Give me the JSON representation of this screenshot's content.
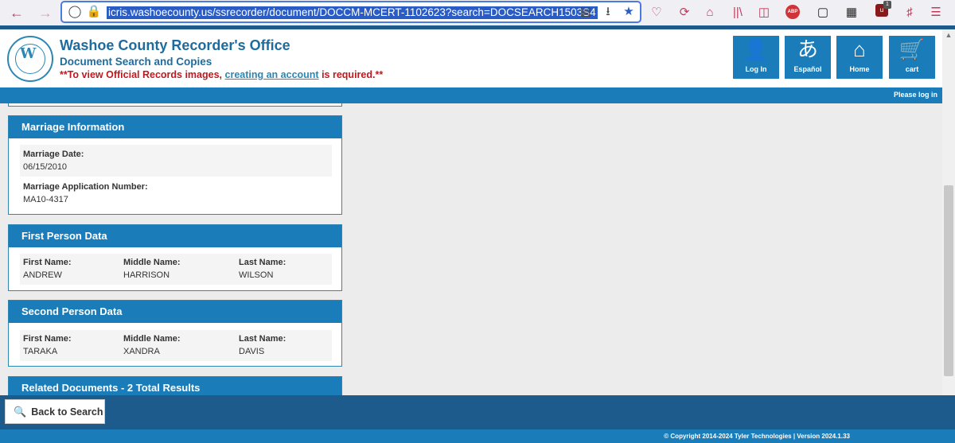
{
  "browser": {
    "back_icon": "arrow-left-icon",
    "forward_icon": "arrow-right-icon",
    "url": "icris.washoecounty.us/ssrecorder/document/DOCCM-MCERT-1102623?search=DOCSEARCH1503S4",
    "abp_label": "ABP",
    "ext_badge_label": "1"
  },
  "header": {
    "title": "Washoe County Recorder's Office",
    "subtitle": "Document Search and Copies",
    "notice_prefix": "**To view Official Records images,",
    "notice_link": "creating an account",
    "notice_suffix": "is required.**",
    "buttons": [
      {
        "label": "Log In",
        "icon": "user-icon"
      },
      {
        "label": "Español",
        "icon": "translate-icon"
      },
      {
        "label": "Home",
        "icon": "home-icon"
      },
      {
        "label": "cart",
        "icon": "cart-icon"
      }
    ],
    "login_prompt": "Please log in"
  },
  "marriage": {
    "heading": "Marriage Information",
    "date_label": "Marriage Date:",
    "date_value": "06/15/2010",
    "app_label": "Marriage Application Number:",
    "app_value": "MA10-4317"
  },
  "first_person": {
    "heading": "First Person Data",
    "first_label": "First Name:",
    "first_value": "ANDREW",
    "middle_label": "Middle Name:",
    "middle_value": "HARRISON",
    "last_label": "Last Name:",
    "last_value": "WILSON"
  },
  "second_person": {
    "heading": "Second Person Data",
    "first_label": "First Name:",
    "first_value": "TARAKA",
    "middle_label": "Middle Name:",
    "middle_value": "XANDRA",
    "last_label": "Last Name:",
    "last_value": "DAVIS"
  },
  "related": {
    "heading": "Related Documents - 2 Total Results"
  },
  "footer": {
    "back_label": "Back to Search",
    "copyright": "© Copyright 2014-2024 Tyler Technologies | Version 2024.1.33"
  }
}
